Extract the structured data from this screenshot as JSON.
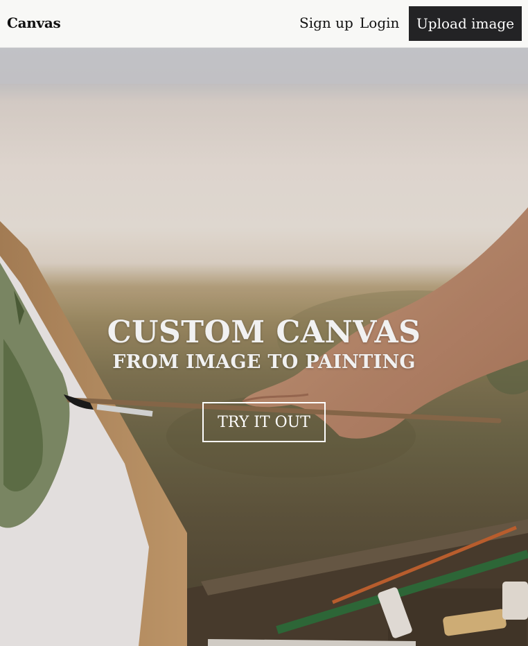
{
  "navbar": {
    "brand": "Canvas",
    "links": [
      {
        "label": "Sign up"
      },
      {
        "label": "Login"
      }
    ],
    "upload_button": "Upload image"
  },
  "hero": {
    "title": "CUSTOM CANVAS",
    "subtitle": "FROM IMAGE TO PAINTING",
    "cta_label": "TRY IT OUT",
    "image_subject": "hand painting on canvas easel outdoors"
  }
}
